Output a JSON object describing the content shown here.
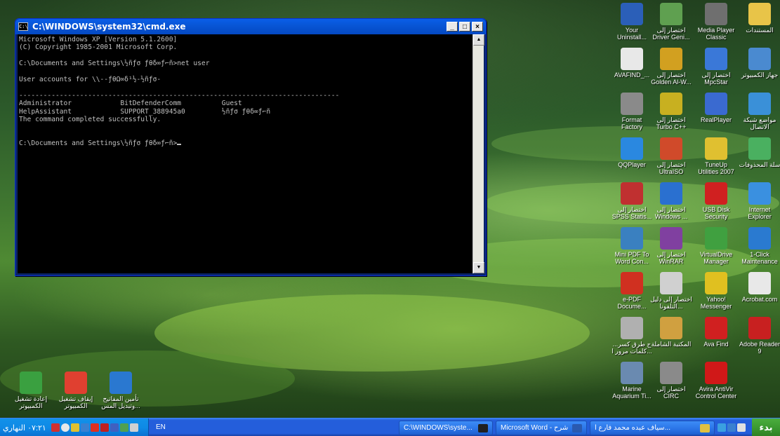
{
  "cmd_window": {
    "title": "C:\\WINDOWS\\system32\\cmd.exe",
    "lines": [
      "Microsoft Windows XP [Version 5.1.2600]",
      "(C) Copyright 1985-2001 Microsoft Corp.",
      "",
      "C:\\Documents and Settings\\½ñƒσ ƒθδ∞ƒ⌐ñ>net user",
      "",
      "User accounts for \\\\--ƒθΩ∞δ¹½-½ñƒσ-",
      "",
      "-------------------------------------------------------------------------------",
      "Administrator            BitDefenderComm          Guest",
      "HelpAssistant            SUPPORT_388945a0         ½ñƒσ ƒθδ∞ƒ⌐ñ",
      "The command completed successfully.",
      "",
      "",
      "C:\\Documents and Settings\\½ñƒσ ƒθδ∞ƒ⌐ñ>"
    ]
  },
  "desktop_icons": [
    {
      "label": "Your Uninstall...",
      "icon": "uninstaller-icon",
      "color": "#2b5fb8"
    },
    {
      "label": "اختصار إلى Driver Geni...",
      "icon": "driver-genius-icon",
      "color": "#5fa050"
    },
    {
      "label": "Media Player Classic",
      "icon": "media-player-icon",
      "color": "#6f6f6f"
    },
    {
      "label": "المستندات",
      "icon": "my-documents-icon",
      "color": "#e8c448"
    },
    {
      "label": "AVAFIND_...",
      "icon": "text-file-icon",
      "color": "#e8e8e8"
    },
    {
      "label": "اختصار إلى Golden Al-W...",
      "icon": "golden-alwafi-icon",
      "color": "#d2a020"
    },
    {
      "label": "اختصار إلى MpcStar",
      "icon": "mpcstar-icon",
      "color": "#3a78d8"
    },
    {
      "label": "جهاز الكمبيوتر",
      "icon": "my-computer-icon",
      "color": "#4a8ad0"
    },
    {
      "label": "Format Factory",
      "icon": "format-factory-icon",
      "color": "#8a8a8a"
    },
    {
      "label": "اختصار إلى Turbo C++",
      "icon": "turbo-cpp-icon",
      "color": "#c8b020"
    },
    {
      "label": "RealPlayer",
      "icon": "realplayer-icon",
      "color": "#3a6ad0"
    },
    {
      "label": "مواضع شبكة الاتصال",
      "icon": "network-places-icon",
      "color": "#3a90d8"
    },
    {
      "label": "QQPlayer",
      "icon": "qqplayer-icon",
      "color": "#2a88e0"
    },
    {
      "label": "اختصار إلى UltraISO",
      "icon": "ultraiso-icon",
      "color": "#d04a2a"
    },
    {
      "label": "TuneUp Utilities 2007",
      "icon": "tuneup-icon",
      "color": "#e0c030"
    },
    {
      "label": "سلة المحذوفات",
      "icon": "recycle-bin-icon",
      "color": "#4ab060"
    },
    {
      "label": "اختصار إلى SPSS Statis...",
      "icon": "spss-icon",
      "color": "#c03030"
    },
    {
      "label": "اختصار إلى Windows ...",
      "icon": "windows-media-icon",
      "color": "#2a70d0"
    },
    {
      "label": "USB Disk Security",
      "icon": "usb-disk-security-icon",
      "color": "#d02020"
    },
    {
      "label": "Internet Explorer",
      "icon": "internet-explorer-icon",
      "color": "#3a90e0"
    },
    {
      "label": "Mini PDF To Word Con...",
      "icon": "mini-pdf-icon",
      "color": "#3a80c0"
    },
    {
      "label": "اختصار إلى WinRAR",
      "icon": "winrar-icon",
      "color": "#8040a0"
    },
    {
      "label": "VirtualDrive Manager",
      "icon": "virtualdrive-icon",
      "color": "#40a040"
    },
    {
      "label": "1-Click Maintenance",
      "icon": "one-click-icon",
      "color": "#2a7ad0"
    },
    {
      "label": "e-PDF Docume...",
      "icon": "epdf-icon",
      "color": "#d03020"
    },
    {
      "label": "اختصار إلى دليل التلفونا...",
      "icon": "phone-directory-icon",
      "color": "#d0d0d0"
    },
    {
      "label": "Yahoo! Messenger",
      "icon": "yahoo-messenger-icon",
      "color": "#e0c020"
    },
    {
      "label": "Acrobat.com",
      "icon": "acrobat-com-icon",
      "color": "#e8e8e8"
    },
    {
      "label": "ج طرق كسر... كلمات مرور ا...",
      "icon": "document-icon",
      "color": "#b0b0b0"
    },
    {
      "label": "المكتبة الشاملة",
      "icon": "library-icon",
      "color": "#d0a040"
    },
    {
      "label": "Ava Find",
      "icon": "ava-find-icon",
      "color": "#d02020"
    },
    {
      "label": "Adobe Reader 9",
      "icon": "adobe-reader-icon",
      "color": "#c82020"
    },
    {
      "label": "Marine Aquarium Ti...",
      "icon": "aquarium-icon",
      "color": "#6a8ab0"
    },
    {
      "label": "اختصار إلى CIRC",
      "icon": "circ-icon",
      "color": "#8a8a8a"
    },
    {
      "label": "Avira AntiVir Control Center",
      "icon": "avira-icon",
      "color": "#d01818"
    }
  ],
  "power_icons": [
    {
      "label": "إعادة تشغيل الكمبيوتر",
      "icon": "restart-icon",
      "color": "#3aa040"
    },
    {
      "label": "إيقاف تشغيل الكمبيوتر",
      "icon": "shutdown-icon",
      "color": "#e04030"
    },
    {
      "label": "تأمين المفاتيح وتبديل المس...",
      "icon": "lock-switch-icon",
      "color": "#2a78d0"
    }
  ],
  "taskbar": {
    "clock": "٠٧:٢١ النهاري",
    "language": "EN",
    "tasks": [
      {
        "label": "C:\\WINDOWS\\syste...",
        "icon": "cmd-icon",
        "color": "#202020"
      },
      {
        "label": "Microsoft Word - شرح ...",
        "icon": "word-icon",
        "color": "#2a5ab0"
      },
      {
        "label": "سياف عبده محمد فارع ا...",
        "icon": "folder-icon",
        "color": "#e0c040"
      }
    ],
    "start_label": "بدء"
  }
}
